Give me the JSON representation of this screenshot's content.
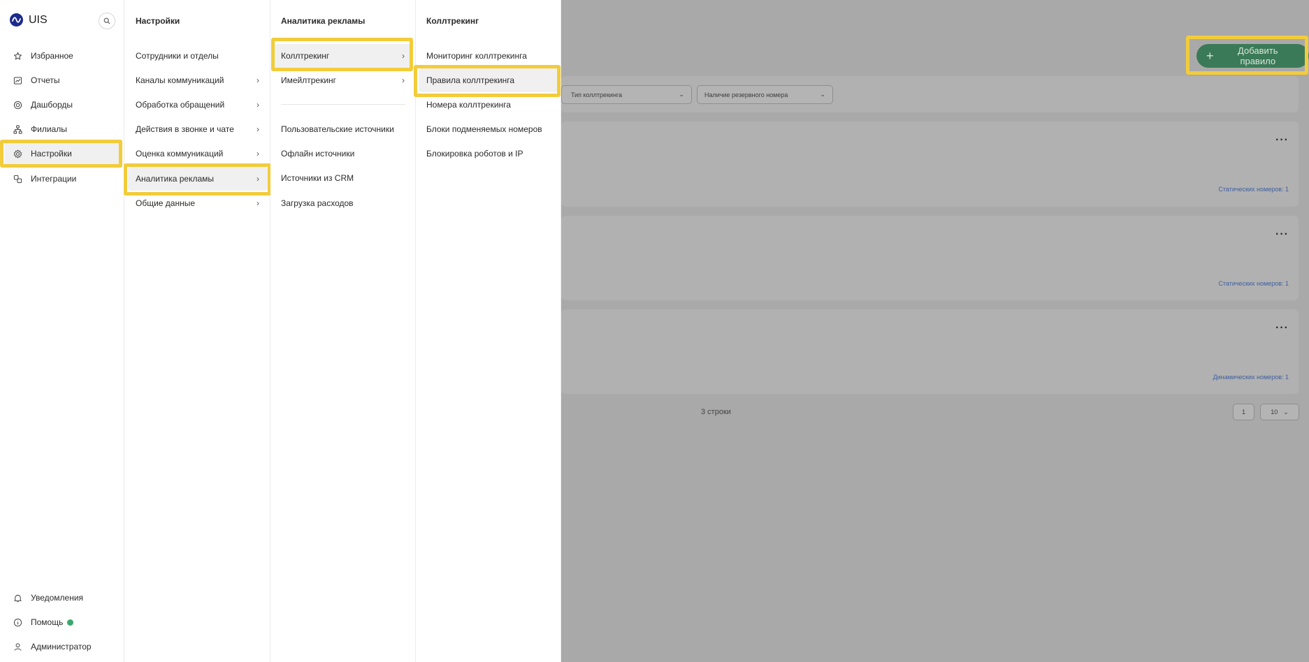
{
  "app": {
    "name": "UIS"
  },
  "sidebar": {
    "items": [
      {
        "label": "Избранное",
        "icon": "star-icon"
      },
      {
        "label": "Отчеты",
        "icon": "report-icon"
      },
      {
        "label": "Дашборды",
        "icon": "dashboard-icon"
      },
      {
        "label": "Филиалы",
        "icon": "branches-icon"
      },
      {
        "label": "Настройки",
        "icon": "gear-icon",
        "active": true
      },
      {
        "label": "Интеграции",
        "icon": "integrations-icon"
      }
    ],
    "bottom": [
      {
        "label": "Уведомления",
        "icon": "bell-icon"
      },
      {
        "label": "Помощь",
        "icon": "info-icon",
        "status_color": "#3ba66b"
      },
      {
        "label": "Администратор",
        "icon": "user-icon"
      }
    ]
  },
  "settings_menu": {
    "title": "Настройки",
    "items": [
      {
        "label": "Сотрудники и отделы"
      },
      {
        "label": "Каналы коммуникаций",
        "has_submenu": true
      },
      {
        "label": "Обработка обращений",
        "has_submenu": true
      },
      {
        "label": "Действия в звонке и чате",
        "has_submenu": true
      },
      {
        "label": "Оценка коммуникаций",
        "has_submenu": true
      },
      {
        "label": "Аналитика рекламы",
        "has_submenu": true,
        "active": true
      },
      {
        "label": "Общие данные",
        "has_submenu": true
      }
    ]
  },
  "ads_menu": {
    "title": "Аналитика рекламы",
    "items": [
      {
        "label": "Коллтрекинг",
        "has_submenu": true,
        "active": true
      },
      {
        "label": "Имейлтрекинг",
        "has_submenu": true
      },
      {
        "label": "Пользовательские источники"
      },
      {
        "label": "Офлайн источники"
      },
      {
        "label": "Источники из CRM"
      },
      {
        "label": "Загрузка расходов"
      }
    ]
  },
  "calltracking_menu": {
    "title": "Коллтрекинг",
    "items": [
      {
        "label": "Мониторинг коллтрекинга"
      },
      {
        "label": "Правила коллтрекинга",
        "active": true
      },
      {
        "label": "Номера коллтрекинга"
      },
      {
        "label": "Блоки подменяемых номеров"
      },
      {
        "label": "Блокировка роботов и IP"
      }
    ]
  },
  "page": {
    "add_button": "Добавить правило",
    "filters": [
      "Тип коллтрекинга",
      "Наличие резервного номера"
    ],
    "cards": [
      {
        "numbers": "Статических номеров: 1"
      },
      {
        "numbers": "Статических номеров: 1"
      },
      {
        "numbers": "Динамических номеров: 1"
      }
    ],
    "rows_count": "3 строки",
    "pagination": {
      "page": "1",
      "page_size": "10"
    }
  },
  "highlight_color": "#f2cc3a"
}
